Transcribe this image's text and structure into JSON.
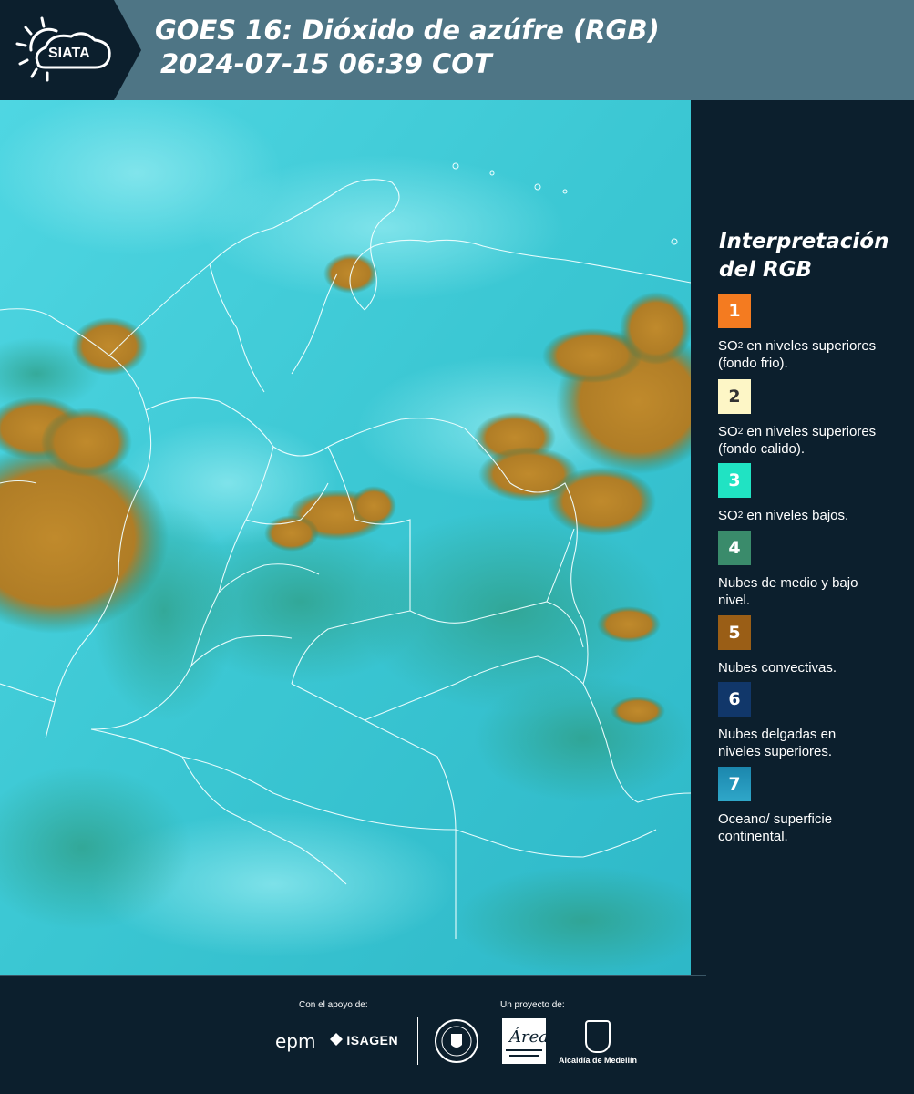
{
  "header": {
    "logo_text": "SIATA",
    "title_line1": "GOES 16: Dióxido de azúfre (RGB)",
    "title_line2": "2024-07-15 06:39 COT"
  },
  "legend": {
    "title": "Interpretación del RGB",
    "items": [
      {
        "number": "1",
        "color": "#f47b20",
        "label_before": "SO",
        "label_sup": "2",
        "label_after": " en niveles superiores (fondo frio)."
      },
      {
        "number": "2",
        "color": "#fdf6c6",
        "label_before": "SO",
        "label_sup": "2",
        "label_after": " en niveles superiores (fondo calido)."
      },
      {
        "number": "3",
        "color": "#20e3c3",
        "label_before": "SO",
        "label_sup": "2",
        "label_after": " en niveles bajos."
      },
      {
        "number": "4",
        "color": "#3a8b6b",
        "label_before": "",
        "label_sup": "",
        "label_after": "Nubes de medio y bajo nivel."
      },
      {
        "number": "5",
        "color": "#9a5e16",
        "label_before": "",
        "label_sup": "",
        "label_after": "Nubes convectivas."
      },
      {
        "number": "6",
        "color": "#11376a",
        "label_before": "",
        "label_sup": "",
        "label_after": "Nubes delgadas en niveles superiores."
      },
      {
        "number": "7",
        "color": "#1b86ad",
        "label_before": "",
        "label_sup": "",
        "label_after": "Oceano/ superficie continental."
      }
    ]
  },
  "footer": {
    "support_label": "Con el apoyo de:",
    "project_label": "Un proyecto de:",
    "sponsor_1": "epm",
    "sponsor_2": "ISAGEN",
    "logo_area": "Área Metropolitana Valle de Aburrá",
    "logo_alcaldia": "Alcaldía de Medellín"
  },
  "colors": {
    "header_bg": "#4e7585",
    "panel_bg": "#0c1f2d",
    "map_base": "#36c8d8",
    "convective": "#b8862a"
  }
}
